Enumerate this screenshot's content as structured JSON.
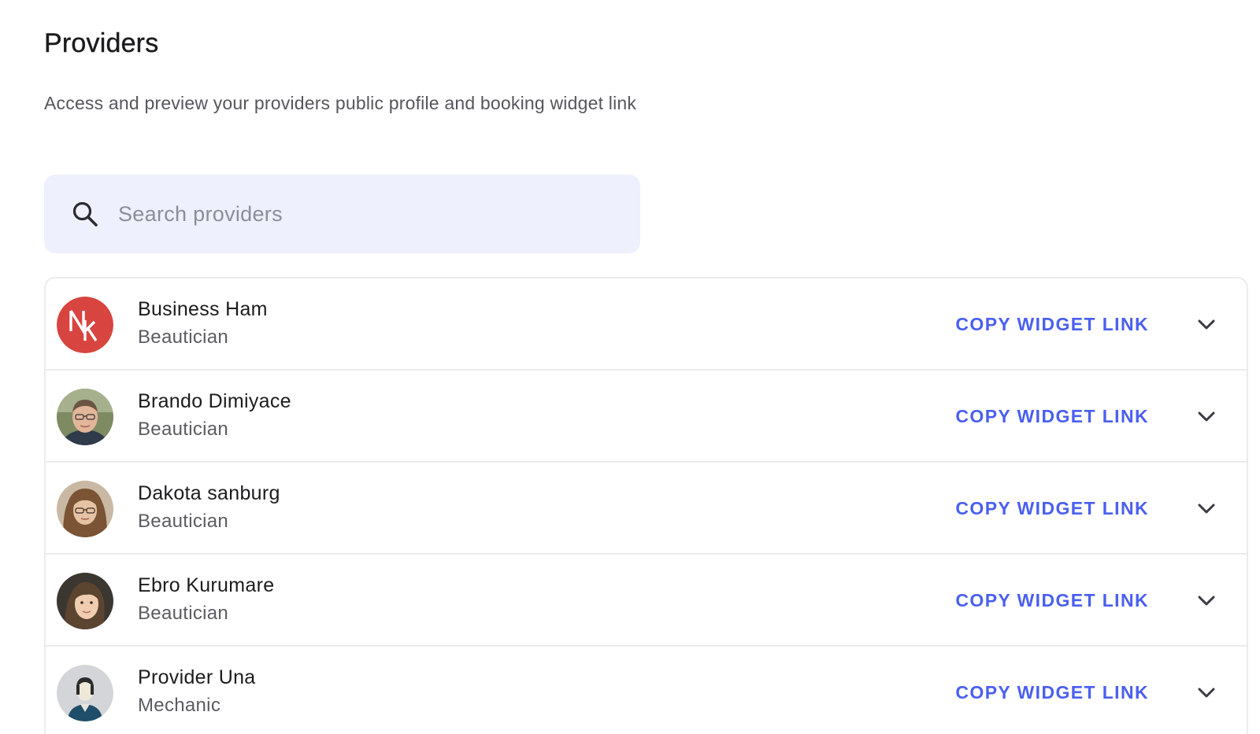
{
  "header": {
    "title": "Providers",
    "subtitle": "Access and preview your providers public profile and booking widget link"
  },
  "search": {
    "placeholder": "Search providers",
    "value": "",
    "icon": "search-icon"
  },
  "providers": [
    {
      "name": "Business Ham",
      "role": "Beautician",
      "action_label": "COPY WIDGET LINK",
      "avatar": "logo-nk"
    },
    {
      "name": "Brando Dimiyace",
      "role": "Beautician",
      "action_label": "COPY WIDGET LINK",
      "avatar": "photo-man-glasses"
    },
    {
      "name": "Dakota sanburg",
      "role": "Beautician",
      "action_label": "COPY WIDGET LINK",
      "avatar": "photo-woman-glasses"
    },
    {
      "name": "Ebro Kurumare",
      "role": "Beautician",
      "action_label": "COPY WIDGET LINK",
      "avatar": "photo-woman"
    },
    {
      "name": "Provider Una",
      "role": "Mechanic",
      "action_label": "COPY WIDGET LINK",
      "avatar": "default-user"
    }
  ],
  "colors": {
    "accent": "#4a5ff0",
    "search_bg": "#eef0fd",
    "avatar_logo_red": "#d8443f"
  }
}
